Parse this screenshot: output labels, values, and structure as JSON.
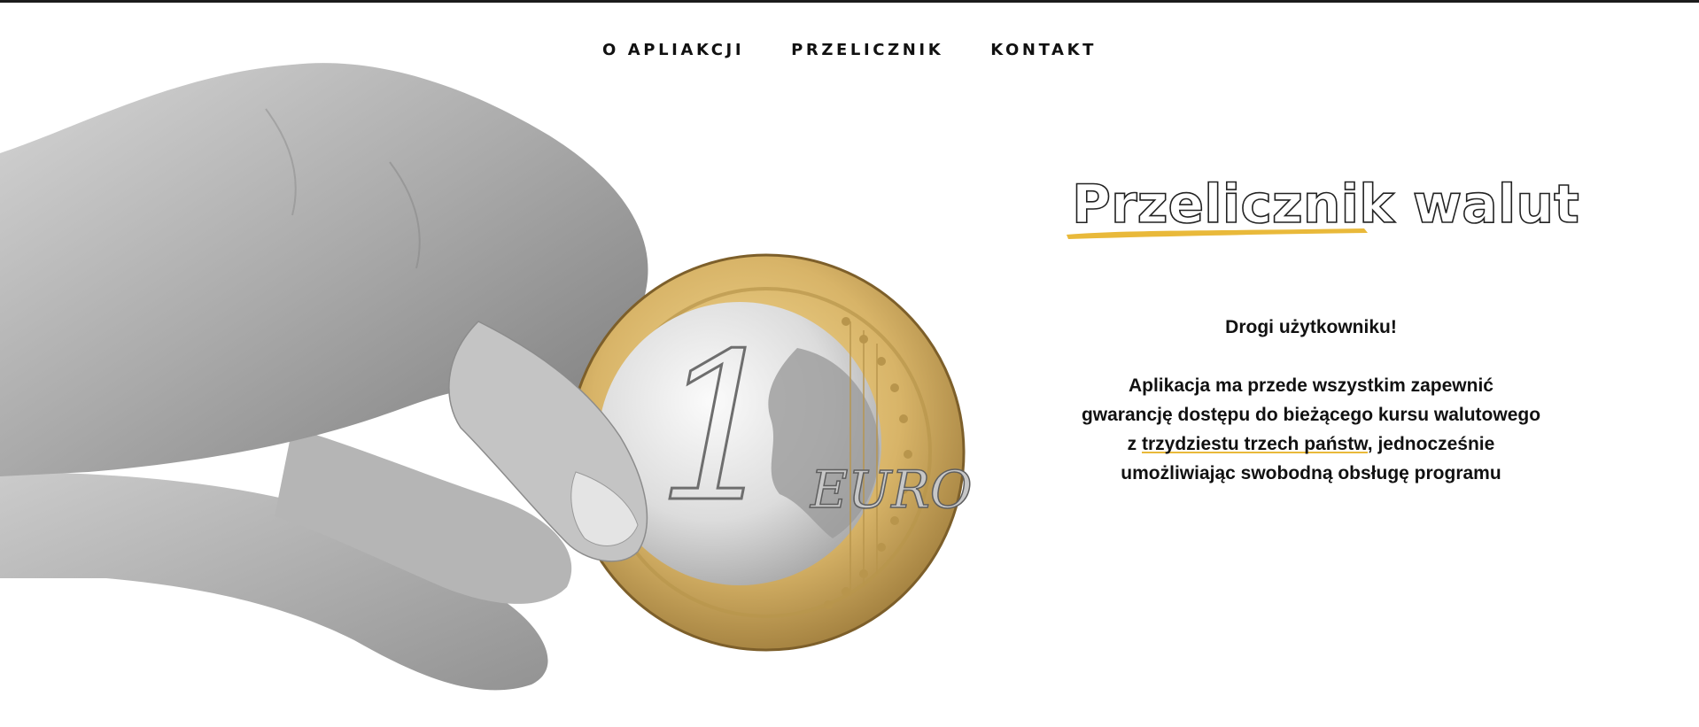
{
  "nav": {
    "items": [
      {
        "label": "O APLIAKCJI"
      },
      {
        "label": "PRZELICZNIK"
      },
      {
        "label": "KONTAKT"
      }
    ]
  },
  "hero": {
    "image_icon": "hand-holding-euro-coin",
    "coin_numeral": "1",
    "coin_text": "EURO"
  },
  "title": {
    "text": "Przelicznik walut",
    "accent_color": "#e9b93a"
  },
  "intro": {
    "greeting": "Drogi użytkowniku!",
    "body_before": "Aplikacja ma przede wszystkim zapewnić gwarancję dostępu do bieżącego kursu walutowego z ",
    "body_highlight": "trzydziestu trzech państw",
    "body_after": ", jednocześnie umożliwiając swobodną obsługę programu"
  }
}
